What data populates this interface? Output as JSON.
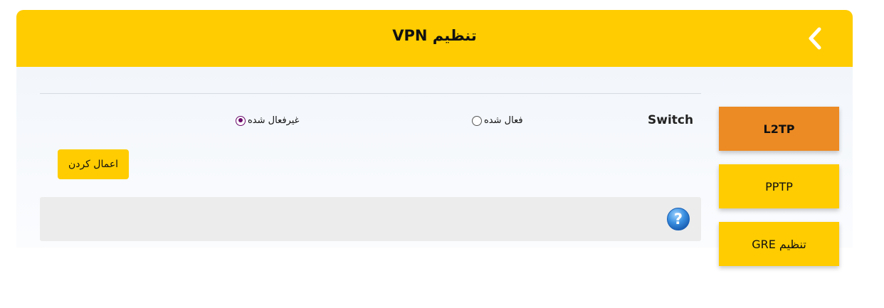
{
  "header": {
    "title": "تنظیم VPN",
    "back_icon": "chevron-left-icon",
    "color": "#fecc00"
  },
  "form": {
    "switch_label": "Switch",
    "options": [
      {
        "label": "فعال شده",
        "checked": false
      },
      {
        "label": "غیرفعال شده",
        "checked": true
      }
    ],
    "apply_label": "اعمال کردن"
  },
  "help": {
    "icon": "help-icon"
  },
  "tabs": [
    {
      "label": "L2TP",
      "active": true
    },
    {
      "label": "PPTP",
      "active": false
    },
    {
      "label": "تنظیم GRE",
      "active": false
    }
  ],
  "colors": {
    "accent": "#fecc00",
    "active_tab": "#ec8a23",
    "radio_checked": "#6b0a6b"
  }
}
